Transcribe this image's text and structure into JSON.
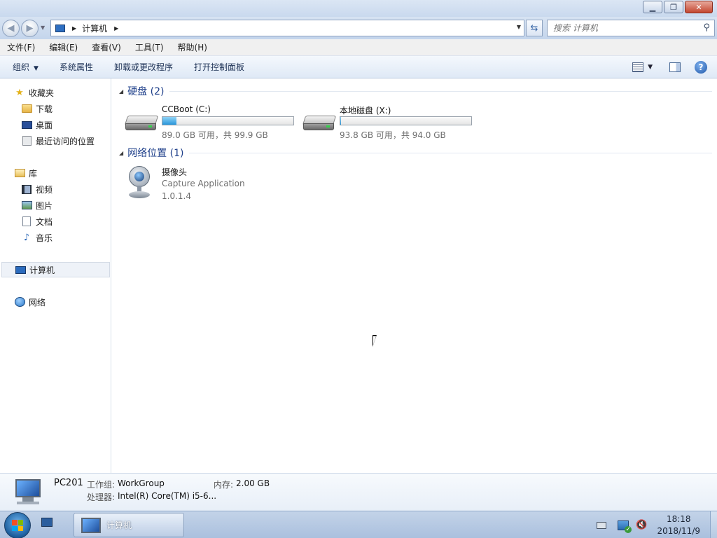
{
  "window": {
    "minimize_icon": "minimize-icon",
    "maximize_icon": "restore-icon",
    "close_icon": "close-icon"
  },
  "address_bar": {
    "current": "计算机",
    "search_placeholder": "搜索 计算机"
  },
  "menu": {
    "items": [
      "文件(F)",
      "编辑(E)",
      "查看(V)",
      "工具(T)",
      "帮助(H)"
    ]
  },
  "command_bar": {
    "organize": "组织",
    "items": [
      "系统属性",
      "卸载或更改程序",
      "打开控制面板"
    ]
  },
  "nav_pane": {
    "favorites": "收藏夹",
    "favorites_items": [
      "下载",
      "桌面",
      "最近访问的位置"
    ],
    "libraries": "库",
    "library_items": [
      "视频",
      "图片",
      "文档",
      "音乐"
    ],
    "computer": "计算机",
    "network": "网络"
  },
  "content": {
    "hard_drives_header": "硬盘 (2)",
    "drives": [
      {
        "name": "CCBoot (C:)",
        "info": "89.0 GB 可用，共 99.9 GB",
        "used_fraction": 0.109
      },
      {
        "name": "本地磁盘 (X:)",
        "info": "93.8 GB 可用，共 94.0 GB",
        "used_fraction": 0.002
      }
    ],
    "network_header": "网络位置 (1)",
    "network_items": [
      {
        "name": "摄像头",
        "description": "Capture Application",
        "version": "1.0.1.4"
      }
    ]
  },
  "details": {
    "pc_name": "PC201",
    "workgroup_label": "工作组:",
    "workgroup_value": "WorkGroup",
    "memory_label": "内存:",
    "memory_value": "2.00 GB",
    "processor_label": "处理器:",
    "processor_value": "Intel(R) Core(TM) i5-6..."
  },
  "taskbar": {
    "window_button": "计算机",
    "time": "18:18",
    "date": "2018/11/9"
  },
  "colors": {
    "accent": "#1e3f8a",
    "drive_fill": "#2996da"
  }
}
